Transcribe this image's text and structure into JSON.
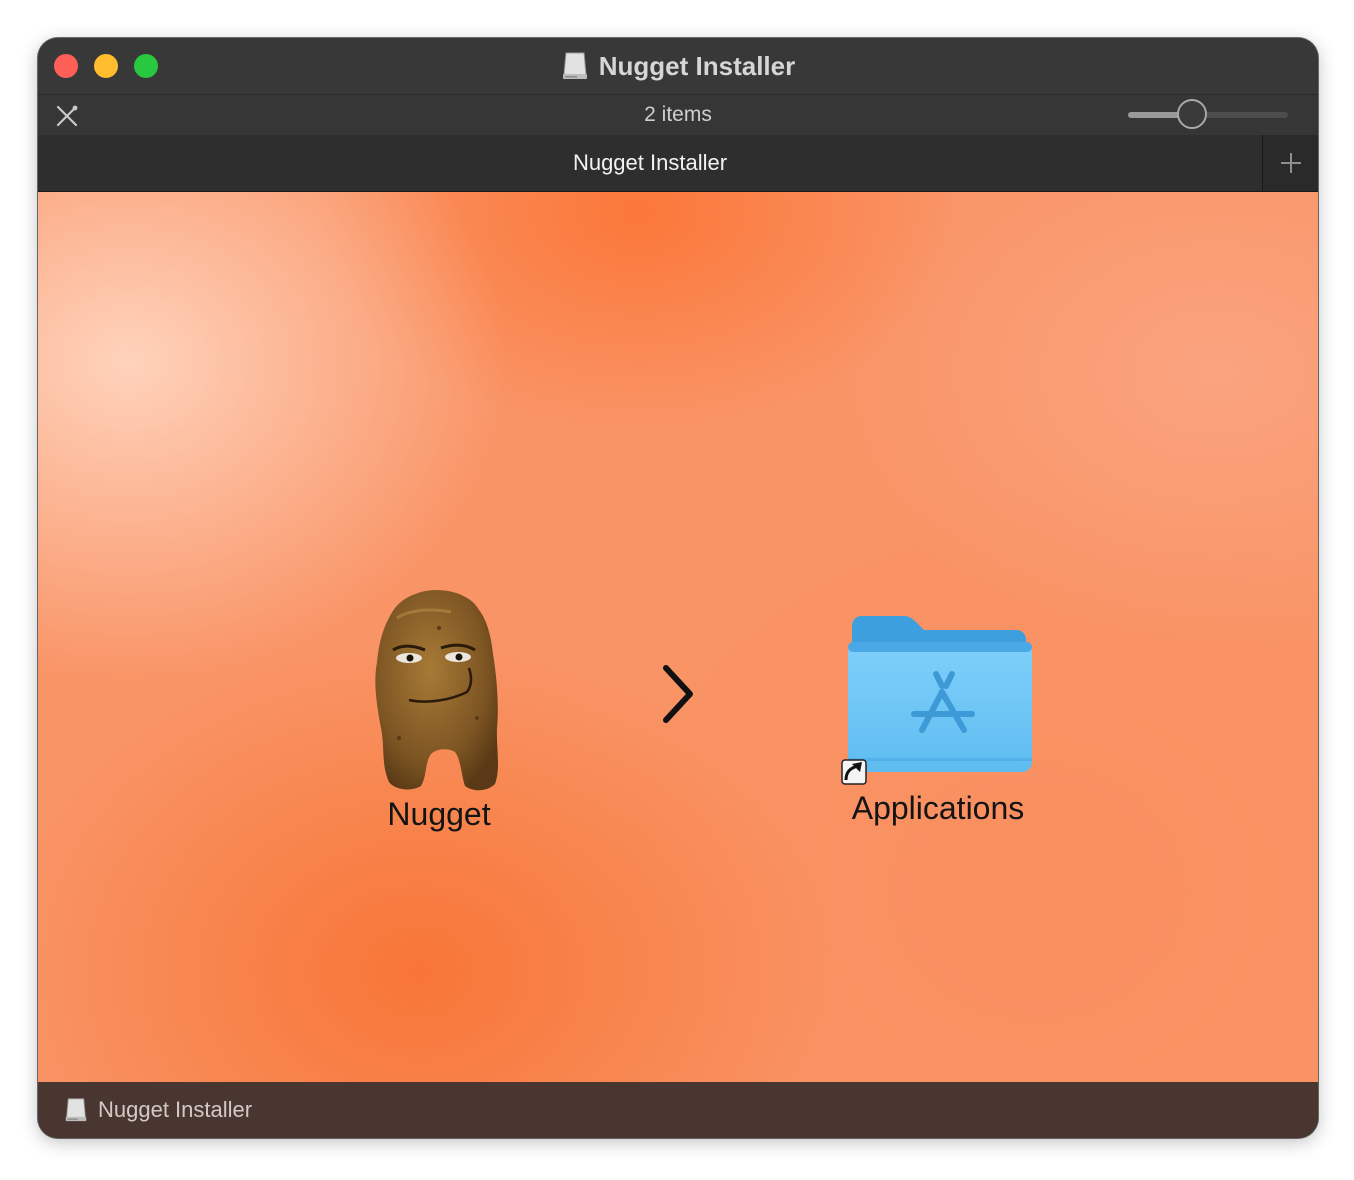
{
  "window": {
    "title": "Nugget Installer",
    "title_icon": "disk-image-icon"
  },
  "toolbar": {
    "items_count": "2 items",
    "icon_size_slider": 0.4
  },
  "tab": {
    "label": "Nugget Installer",
    "add_icon": "plus-icon"
  },
  "content": {
    "items": [
      {
        "label": "Nugget",
        "icon": "nugget-app-icon"
      },
      {
        "label": "Applications",
        "icon": "applications-folder-icon"
      }
    ],
    "arrow_icon": "chevron-right-icon"
  },
  "footer": {
    "path_label": "Nugget Installer",
    "icon": "disk-image-icon"
  },
  "colors": {
    "background_accent": "#f99466",
    "folder_blue": "#6cc5f5",
    "footer": "#4a3631"
  }
}
